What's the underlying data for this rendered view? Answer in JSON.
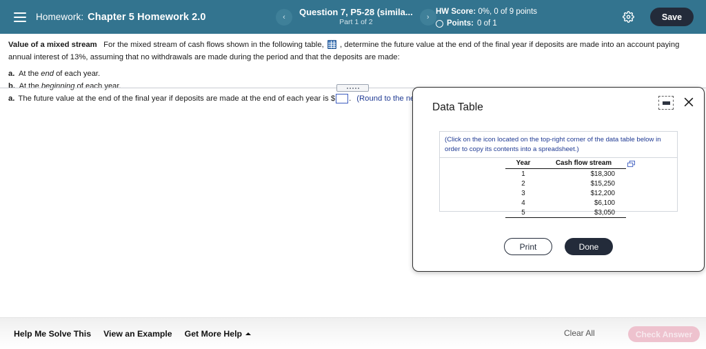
{
  "header": {
    "menu_icon": "hamburger-icon",
    "kicker": "Homework:",
    "title": "Chapter 5 Homework 2.0",
    "prev_label": "‹",
    "next_label": "›",
    "question_label": "Question 7, P5-28 (simila...",
    "part_label": "Part 1 of 2",
    "hw_score_label": "HW Score:",
    "hw_score_value": "0%, 0 of 9 points",
    "points_label": "Points:",
    "points_value": "0 of 1",
    "settings_icon": "gear-icon",
    "save_label": "Save",
    "bg_color": "#33748f",
    "save_bg": "#232b3a"
  },
  "question": {
    "topic": "Value of a mixed stream",
    "text_part1": "For the mixed stream of cash flows shown in the following table,",
    "table_icon": "table-grid-icon",
    "text_part2": ", determine the future value at the end of the final year if deposits are made into an account paying annual interest of 13%, assuming that no withdrawals are made during the period and that the deposits are made:",
    "parts": [
      {
        "label": "a.",
        "pre": "At the ",
        "em": "end",
        "post": " of each year."
      },
      {
        "label": "b.",
        "pre": "At the ",
        "em": "beginning",
        "post": " of each year."
      }
    ]
  },
  "answer": {
    "label": "a.",
    "text_before": "The future value at the end of the final year if deposits are made at the end of each year is $",
    "input_value": "",
    "input_placeholder": "",
    "text_after": ".",
    "note": "(Round to the nearest dollar.)"
  },
  "splitter": {
    "name": "panel-splitter-handle"
  },
  "dialog": {
    "title": "Data Table",
    "minimize_icon": "minimize-icon",
    "close_icon": "close-icon",
    "note": "(Click on the icon located on the top-right corner of the data table below in order to copy its contents into a spreadsheet.)",
    "copy_icon": "copy-icon",
    "table": {
      "headers": [
        "Year",
        "Cash flow stream"
      ],
      "rows": [
        {
          "year": "1",
          "cash": "$18,300"
        },
        {
          "year": "2",
          "cash": "$15,250"
        },
        {
          "year": "3",
          "cash": "$12,200"
        },
        {
          "year": "4",
          "cash": "$6,100"
        },
        {
          "year": "5",
          "cash": "$3,050"
        }
      ]
    },
    "print_label": "Print",
    "done_label": "Done"
  },
  "footer": {
    "links": [
      {
        "label": "Help Me Solve This",
        "caret": false
      },
      {
        "label": "View an Example",
        "caret": false
      },
      {
        "label": "Get More Help",
        "caret": true
      }
    ],
    "clear_all": "Clear All",
    "check_answer": "Check Answer",
    "check_answer_bg": "#eec2ce"
  }
}
